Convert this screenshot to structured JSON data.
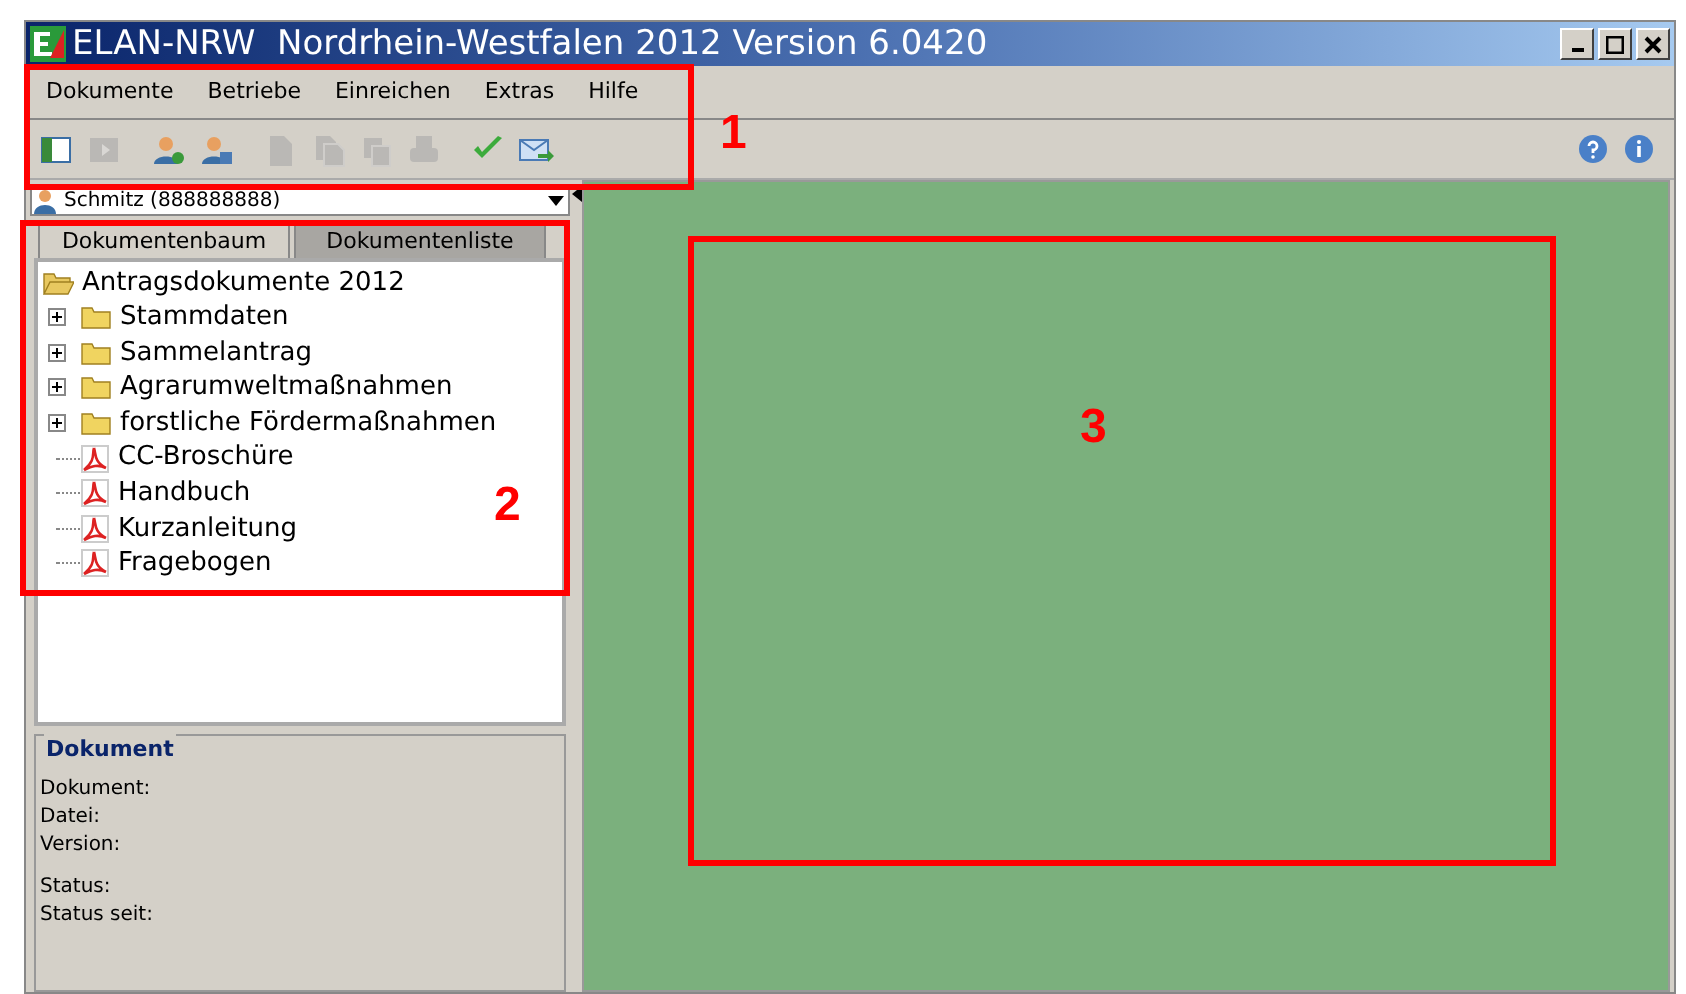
{
  "window": {
    "title": "ELAN-NRW  Nordrhein-Westfalen 2012 Version 6.0420"
  },
  "menu": [
    "Dokumente",
    "Betriebe",
    "Einreichen",
    "Extras",
    "Hilfe"
  ],
  "toolbar": [
    {
      "kind": "panel-in",
      "disabled": false
    },
    {
      "kind": "panel-out",
      "disabled": true
    },
    {
      "kind": "user-add",
      "disabled": false
    },
    {
      "kind": "user-save",
      "disabled": false
    },
    {
      "kind": "doc",
      "disabled": true
    },
    {
      "kind": "docs",
      "disabled": true
    },
    {
      "kind": "copy",
      "disabled": true
    },
    {
      "kind": "print",
      "disabled": true
    },
    {
      "kind": "check",
      "disabled": false
    },
    {
      "kind": "mail",
      "disabled": false
    }
  ],
  "farm_select": {
    "value": "Schmitz (888888888)"
  },
  "tabs": [
    {
      "label": "Dokumentenbaum",
      "selected": true
    },
    {
      "label": "Dokumentenliste",
      "selected": false
    }
  ],
  "tree": {
    "label": "Antragsdokumente 2012",
    "expanded": true,
    "children": [
      {
        "kind": "folder",
        "label": "Stammdaten",
        "expanded": false
      },
      {
        "kind": "folder",
        "label": "Sammelantrag",
        "expanded": false
      },
      {
        "kind": "folder",
        "label": "Agrarumweltmaßnahmen",
        "expanded": false
      },
      {
        "kind": "folder",
        "label": "forstliche Fördermaßnahmen",
        "expanded": false
      },
      {
        "kind": "pdf",
        "label": "CC-Broschüre"
      },
      {
        "kind": "pdf",
        "label": "Handbuch"
      },
      {
        "kind": "pdf",
        "label": "Kurzanleitung"
      },
      {
        "kind": "pdf",
        "label": "Fragebogen"
      }
    ]
  },
  "document_panel": {
    "title": "Dokument",
    "fields": [
      "Dokument:",
      "Datei:",
      "Version:",
      "Status:",
      "Status seit:"
    ]
  },
  "annotations": [
    "1",
    "2",
    "3"
  ]
}
